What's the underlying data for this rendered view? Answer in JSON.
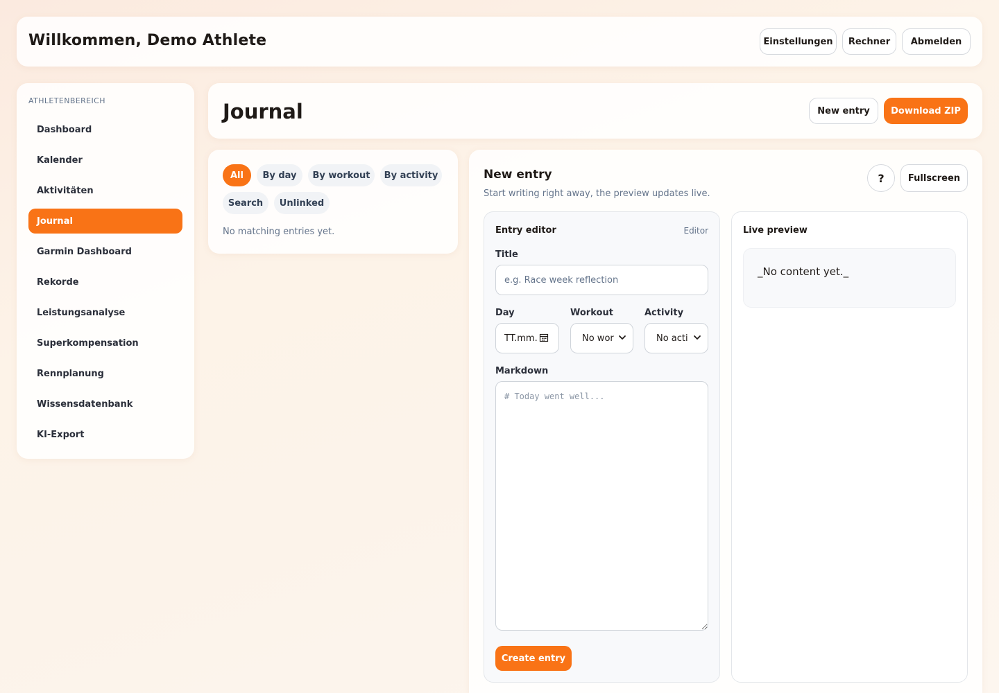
{
  "header": {
    "welcome": "Willkommen, Demo Athlete",
    "buttons": [
      "Einstellungen",
      "Rechner",
      "Abmelden"
    ]
  },
  "sidebar": {
    "heading": "ATHLETENBEREICH",
    "items": [
      {
        "label": "Dashboard"
      },
      {
        "label": "Kalender"
      },
      {
        "label": "Aktivitäten"
      },
      {
        "label": "Journal",
        "active": true
      },
      {
        "label": "Garmin Dashboard"
      },
      {
        "label": "Rekorde"
      },
      {
        "label": "Leistungsanalyse"
      },
      {
        "label": "Superkompensation"
      },
      {
        "label": "Rennplanung"
      },
      {
        "label": "Wissensdatenbank"
      },
      {
        "label": "KI-Export"
      }
    ]
  },
  "journal": {
    "title": "Journal",
    "new_entry_label": "New entry",
    "download_label": "Download ZIP"
  },
  "filters": {
    "chips": [
      "All",
      "By day",
      "By workout",
      "By activity",
      "Search",
      "Unlinked"
    ],
    "active": "All",
    "empty_text": "No matching entries yet."
  },
  "editor": {
    "title": "New entry",
    "subtitle": "Start writing right away, the preview updates live.",
    "help_label": "?",
    "fullscreen_label": "Fullscreen",
    "panel_title": "Entry editor",
    "panel_tag": "Editor",
    "title_label": "Title",
    "title_placeholder": "e.g. Race week reflection",
    "day_label": "Day",
    "day_placeholder": "TT.mm.",
    "workout_label": "Workout",
    "workout_value": "No wor",
    "activity_label": "Activity",
    "activity_value": "No acti",
    "markdown_label": "Markdown",
    "markdown_placeholder": "# Today went well...",
    "create_label": "Create entry"
  },
  "preview": {
    "title": "Live preview",
    "content": "_No content yet._"
  },
  "colors": {
    "accent": "#f97316",
    "muted_text": "#64748b",
    "chip_bg": "#f1f3f6"
  }
}
